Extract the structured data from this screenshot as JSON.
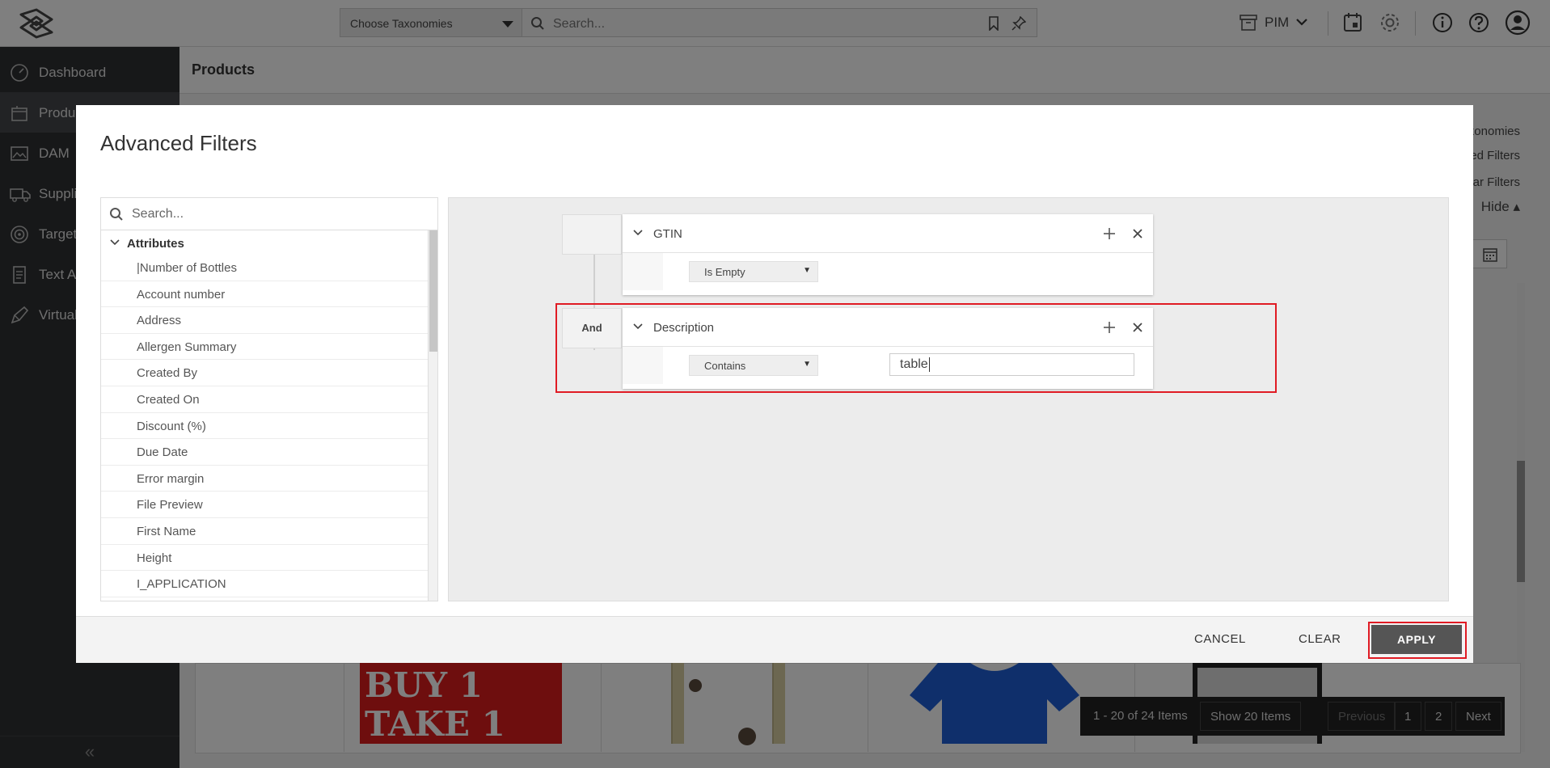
{
  "topbar": {
    "taxonomy_select": "Choose Taxonomies",
    "search_placeholder": "Search...",
    "module": "PIM"
  },
  "sidebar": {
    "items": [
      {
        "label": "Dashboard",
        "icon": "gauge-icon"
      },
      {
        "label": "Products",
        "icon": "box-icon"
      },
      {
        "label": "DAM",
        "icon": "image-icon"
      },
      {
        "label": "Suppliers",
        "icon": "truck-icon"
      },
      {
        "label": "Targets",
        "icon": "target-icon"
      },
      {
        "label": "Text Assets",
        "icon": "document-icon"
      },
      {
        "label": "Virtual",
        "icon": "brush-icon"
      }
    ],
    "collapse_glyph": "«"
  },
  "main": {
    "title": "Products",
    "right_links": [
      "Taxonomies",
      "Saved Filters",
      "Clear Filters",
      "Hide ▴"
    ],
    "promo_text": [
      "BUY 1",
      "TAKE 1"
    ]
  },
  "pager": {
    "range": "1 - 20 of 24 Items",
    "page_size": "Show 20 Items",
    "previous": "Previous",
    "pages": [
      "1",
      "2"
    ],
    "next": "Next"
  },
  "modal": {
    "title": "Advanced Filters",
    "search_placeholder": "Search...",
    "group_label": "Attributes",
    "attributes": [
      "|Number of Bottles",
      "Account number",
      "Address",
      "Allergen Summary",
      "Created By",
      "Created On",
      "Discount (%)",
      "Due Date",
      "Error margin",
      "File Preview",
      "First Name",
      "Height",
      "I_APPLICATION"
    ],
    "rules": [
      {
        "field": "GTIN",
        "operator": "Is Empty",
        "value": ""
      },
      {
        "connector": "And",
        "field": "Description",
        "operator": "Contains",
        "value": "table"
      }
    ],
    "footer": {
      "cancel": "CANCEL",
      "clear": "CLEAR",
      "apply": "APPLY"
    }
  },
  "colors": {
    "sidebar_bg": "#2f3033",
    "highlight": "#e01b24",
    "apply_bg": "#555555"
  }
}
